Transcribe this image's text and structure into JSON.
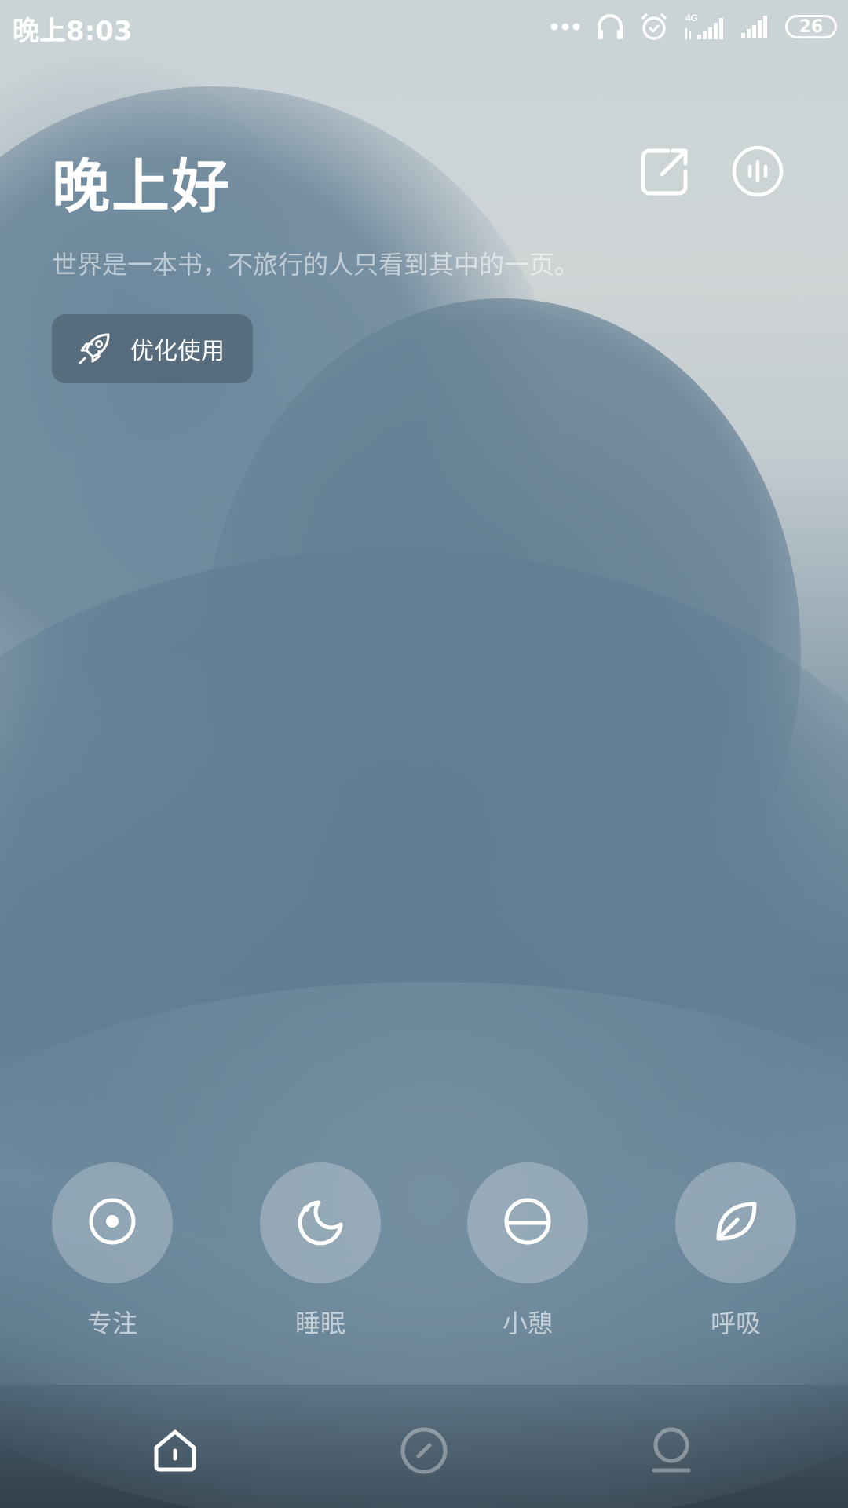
{
  "status_bar": {
    "time": "晚上8:03",
    "network": "4G",
    "battery": "26",
    "icons": [
      "more-dots-icon",
      "headphone-icon",
      "alarm-icon",
      "signal-4g-icon",
      "signal-icon",
      "battery-icon"
    ]
  },
  "header": {
    "greeting": "晚上好",
    "quote": "世界是一本书，不旅行的人只看到其中的一页。",
    "share_icon": "share-icon",
    "sound_icon": "sound-icon"
  },
  "optimize_button": {
    "label": "优化使用",
    "icon": "rocket-icon"
  },
  "features": [
    {
      "label": "专注",
      "icon": "focus-icon"
    },
    {
      "label": "睡眠",
      "icon": "moon-icon"
    },
    {
      "label": "小憩",
      "icon": "nap-icon"
    },
    {
      "label": "呼吸",
      "icon": "leaf-icon"
    }
  ],
  "bottom_nav": {
    "items": [
      {
        "icon": "home-icon",
        "active": true
      },
      {
        "icon": "compass-icon",
        "active": false
      },
      {
        "icon": "profile-icon",
        "active": false
      }
    ]
  },
  "colors": {
    "text_primary": "#ffffff",
    "sky_light": "#cfd4d5",
    "cloud_blue": "#5f7d92"
  }
}
